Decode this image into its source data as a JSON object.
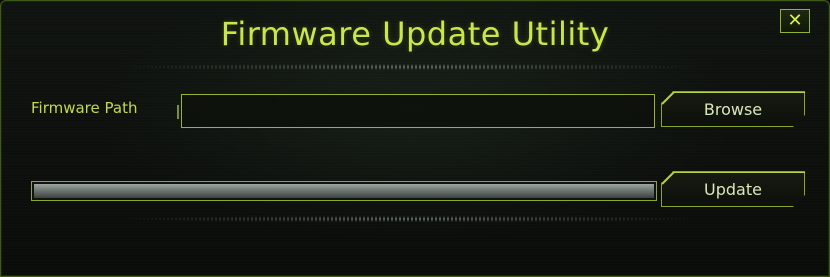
{
  "window": {
    "title": "Firmware Update Utility",
    "close_label": "✕"
  },
  "form": {
    "path_label": "Firmware Path",
    "path_value": "",
    "browse_label": "Browse",
    "update_label": "Update"
  },
  "progress": {
    "value": 1.0
  },
  "colors": {
    "accent": "#c9e64a",
    "border": "#8fb32b",
    "background": "#0b0d0b"
  }
}
